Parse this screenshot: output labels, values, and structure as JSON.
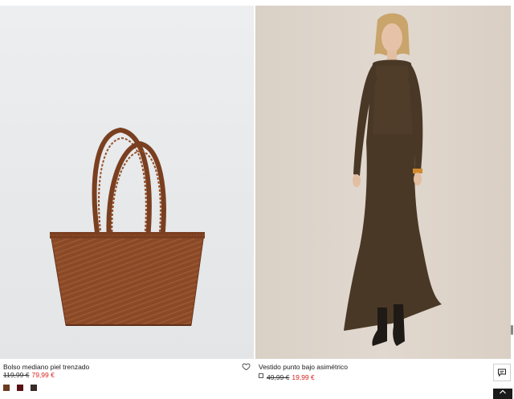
{
  "products": [
    {
      "name": "Bolso mediano piel trenzado",
      "old_price": "119,99 €",
      "new_price": "79,99 €",
      "image": "woven-leather-tote-bag",
      "swatches": [
        "#6b3a22",
        "#5a1014",
        "#3a2a26"
      ]
    },
    {
      "name": "Vestido punto bajo asimétrico",
      "old_price": "49,99 €",
      "new_price": "19,99 €",
      "image": "brown-knit-asymmetric-dress-model"
    }
  ],
  "icons": {
    "wishlist": "heart-icon",
    "chat": "chat-icon",
    "scroll_top": "chevron-up-icon"
  },
  "colors": {
    "sale_price": "#d6231f",
    "bag_brown": "#8a4a28",
    "dress_brown": "#4a3826"
  }
}
